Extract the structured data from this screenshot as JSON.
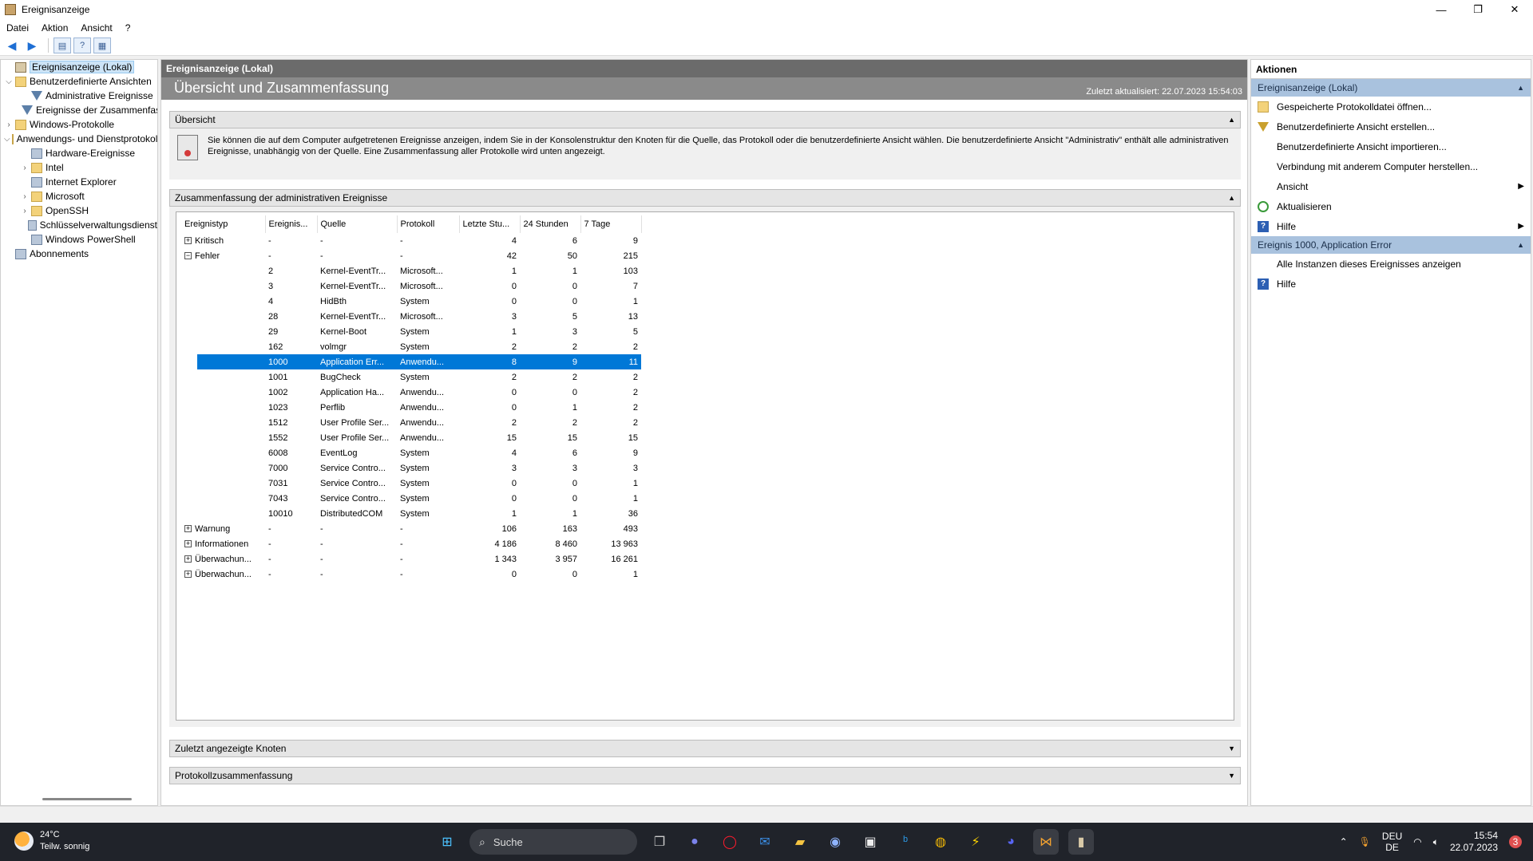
{
  "window": {
    "title": "Ereignisanzeige",
    "controls": {
      "minimize": "—",
      "maximize": "❐",
      "close": "✕"
    }
  },
  "menu": [
    "Datei",
    "Aktion",
    "Ansicht",
    "?"
  ],
  "toolbar": [
    "back-arrow-icon",
    "forward-arrow-icon",
    "console-tree-icon",
    "help-icon",
    "properties-icon"
  ],
  "tree": [
    {
      "label": "Ereignisanzeige (Lokal)",
      "level": 0,
      "exp": "",
      "icon": "log",
      "selected": true
    },
    {
      "label": "Benutzerdefinierte Ansichten",
      "level": 0,
      "exp": "v",
      "icon": "folder"
    },
    {
      "label": "Administrative Ereignisse",
      "level": 1,
      "exp": "",
      "icon": "filter"
    },
    {
      "label": "Ereignisse der Zusammenfassung",
      "level": 1,
      "exp": "",
      "icon": "filter"
    },
    {
      "label": "Windows-Protokolle",
      "level": 0,
      "exp": ">",
      "icon": "folder"
    },
    {
      "label": "Anwendungs- und Dienstprotokolle",
      "level": 0,
      "exp": "v",
      "icon": "folder"
    },
    {
      "label": "Hardware-Ereignisse",
      "level": 1,
      "exp": "",
      "icon": "book"
    },
    {
      "label": "Intel",
      "level": 1,
      "exp": ">",
      "icon": "folder"
    },
    {
      "label": "Internet Explorer",
      "level": 1,
      "exp": "",
      "icon": "book"
    },
    {
      "label": "Microsoft",
      "level": 1,
      "exp": ">",
      "icon": "folder"
    },
    {
      "label": "OpenSSH",
      "level": 1,
      "exp": ">",
      "icon": "folder"
    },
    {
      "label": "Schlüsselverwaltungsdienst",
      "level": 1,
      "exp": "",
      "icon": "book"
    },
    {
      "label": "Windows PowerShell",
      "level": 1,
      "exp": "",
      "icon": "book"
    },
    {
      "label": "Abonnements",
      "level": 0,
      "exp": "",
      "icon": "book"
    }
  ],
  "center": {
    "header": "Ereignisanzeige (Lokal)",
    "banner_title": "Übersicht und Zusammenfassung",
    "updated": "Zuletzt aktualisiert: 22.07.2023 15:54:03",
    "overview_header": "Übersicht",
    "overview_text": "Sie können die auf dem Computer aufgetretenen Ereignisse anzeigen, indem Sie in der Konsolenstruktur den Knoten für die Quelle, das Protokoll oder die benutzerdefinierte Ansicht wählen. Die benutzerdefinierte Ansicht \"Administrativ\" enthält alle administrativen Ereignisse, unabhängig von der Quelle. Eine Zusammenfassung aller Protokolle wird unten angezeigt.",
    "summary_header": "Zusammenfassung der administrativen Ereignisse",
    "recent_header": "Zuletzt angezeigte Knoten",
    "log_summary_header": "Protokollzusammenfassung",
    "columns": [
      "Ereignistyp",
      "Ereignis...",
      "Quelle",
      "Protokoll",
      "Letzte Stu...",
      "24 Stunden",
      "7 Tage"
    ],
    "rows": [
      {
        "type": "Kritisch",
        "pm": "+",
        "id": "-",
        "src": "-",
        "log": "-",
        "h1": "4",
        "h24": "6",
        "d7": "9"
      },
      {
        "type": "Fehler",
        "pm": "-",
        "id": "-",
        "src": "-",
        "log": "-",
        "h1": "42",
        "h24": "50",
        "d7": "215"
      },
      {
        "type": "",
        "pm": "",
        "id": "2",
        "src": "Kernel-EventTr...",
        "log": "Microsoft...",
        "h1": "1",
        "h24": "1",
        "d7": "103"
      },
      {
        "type": "",
        "pm": "",
        "id": "3",
        "src": "Kernel-EventTr...",
        "log": "Microsoft...",
        "h1": "0",
        "h24": "0",
        "d7": "7"
      },
      {
        "type": "",
        "pm": "",
        "id": "4",
        "src": "HidBth",
        "log": "System",
        "h1": "0",
        "h24": "0",
        "d7": "1"
      },
      {
        "type": "",
        "pm": "",
        "id": "28",
        "src": "Kernel-EventTr...",
        "log": "Microsoft...",
        "h1": "3",
        "h24": "5",
        "d7": "13"
      },
      {
        "type": "",
        "pm": "",
        "id": "29",
        "src": "Kernel-Boot",
        "log": "System",
        "h1": "1",
        "h24": "3",
        "d7": "5"
      },
      {
        "type": "",
        "pm": "",
        "id": "162",
        "src": "volmgr",
        "log": "System",
        "h1": "2",
        "h24": "2",
        "d7": "2"
      },
      {
        "type": "",
        "pm": "",
        "id": "1000",
        "src": "Application Err...",
        "log": "Anwendu...",
        "h1": "8",
        "h24": "9",
        "d7": "11",
        "selected": true
      },
      {
        "type": "",
        "pm": "",
        "id": "1001",
        "src": "BugCheck",
        "log": "System",
        "h1": "2",
        "h24": "2",
        "d7": "2"
      },
      {
        "type": "",
        "pm": "",
        "id": "1002",
        "src": "Application Ha...",
        "log": "Anwendu...",
        "h1": "0",
        "h24": "0",
        "d7": "2"
      },
      {
        "type": "",
        "pm": "",
        "id": "1023",
        "src": "Perflib",
        "log": "Anwendu...",
        "h1": "0",
        "h24": "1",
        "d7": "2"
      },
      {
        "type": "",
        "pm": "",
        "id": "1512",
        "src": "User Profile Ser...",
        "log": "Anwendu...",
        "h1": "2",
        "h24": "2",
        "d7": "2"
      },
      {
        "type": "",
        "pm": "",
        "id": "1552",
        "src": "User Profile Ser...",
        "log": "Anwendu...",
        "h1": "15",
        "h24": "15",
        "d7": "15"
      },
      {
        "type": "",
        "pm": "",
        "id": "6008",
        "src": "EventLog",
        "log": "System",
        "h1": "4",
        "h24": "6",
        "d7": "9"
      },
      {
        "type": "",
        "pm": "",
        "id": "7000",
        "src": "Service Contro...",
        "log": "System",
        "h1": "3",
        "h24": "3",
        "d7": "3"
      },
      {
        "type": "",
        "pm": "",
        "id": "7031",
        "src": "Service Contro...",
        "log": "System",
        "h1": "0",
        "h24": "0",
        "d7": "1"
      },
      {
        "type": "",
        "pm": "",
        "id": "7043",
        "src": "Service Contro...",
        "log": "System",
        "h1": "0",
        "h24": "0",
        "d7": "1"
      },
      {
        "type": "",
        "pm": "",
        "id": "10010",
        "src": "DistributedCOM",
        "log": "System",
        "h1": "1",
        "h24": "1",
        "d7": "36"
      },
      {
        "type": "Warnung",
        "pm": "+",
        "id": "-",
        "src": "-",
        "log": "-",
        "h1": "106",
        "h24": "163",
        "d7": "493"
      },
      {
        "type": "Informationen",
        "pm": "+",
        "id": "-",
        "src": "-",
        "log": "-",
        "h1": "4 186",
        "h24": "8 460",
        "d7": "13 963"
      },
      {
        "type": "Überwachun...",
        "pm": "+",
        "id": "-",
        "src": "-",
        "log": "-",
        "h1": "1 343",
        "h24": "3 957",
        "d7": "16 261"
      },
      {
        "type": "Überwachun...",
        "pm": "+",
        "id": "-",
        "src": "-",
        "log": "-",
        "h1": "0",
        "h24": "0",
        "d7": "1"
      }
    ]
  },
  "actions": {
    "title": "Aktionen",
    "group1": "Ereignisanzeige (Lokal)",
    "items1": [
      {
        "label": "Gespeicherte Protokolldatei öffnen...",
        "icon": "open"
      },
      {
        "label": "Benutzerdefinierte Ansicht erstellen...",
        "icon": "filter"
      },
      {
        "label": "Benutzerdefinierte Ansicht importieren...",
        "icon": ""
      },
      {
        "label": "Verbindung mit anderem Computer herstellen...",
        "icon": ""
      },
      {
        "label": "Ansicht",
        "icon": "",
        "submenu": true
      },
      {
        "label": "Aktualisieren",
        "icon": "refresh"
      },
      {
        "label": "Hilfe",
        "icon": "help",
        "submenu": true
      }
    ],
    "group2": "Ereignis 1000, Application Error",
    "items2": [
      {
        "label": "Alle Instanzen dieses Ereignisses anzeigen",
        "icon": ""
      },
      {
        "label": "Hilfe",
        "icon": "help"
      }
    ]
  },
  "taskbar": {
    "temp": "24°C",
    "weather": "Teilw. sonnig",
    "search": "Suche",
    "lang1": "DEU",
    "lang2": "DE",
    "time": "15:54",
    "date": "22.07.2023",
    "notif_count": "3"
  }
}
